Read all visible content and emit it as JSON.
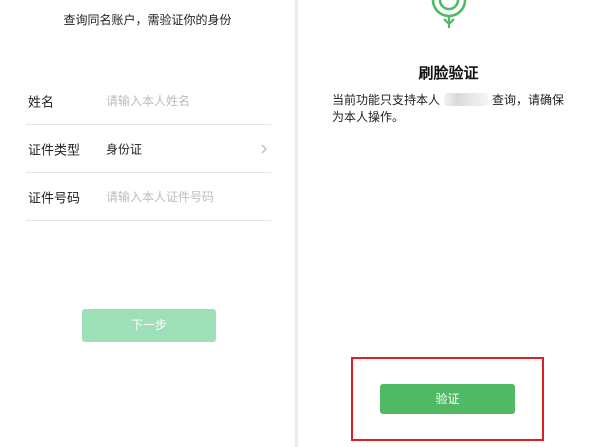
{
  "left_panel": {
    "header": "查询同名账户，需验证你的身份",
    "fields": [
      {
        "label": "姓名",
        "placeholder": "请输入本人姓名"
      },
      {
        "label": "证件类型",
        "value": "身份证"
      },
      {
        "label": "证件号码",
        "placeholder": "请输入本人证件号码"
      }
    ],
    "next_button": "下一步"
  },
  "right_panel": {
    "title": "刷脸验证",
    "desc_prefix": "当前功能只支持本人",
    "desc_suffix": "查询，请确保为本人操作。",
    "verify_button": "验证",
    "highlight_color": "#e02020"
  },
  "colors": {
    "primary_green": "#4fb964",
    "disabled_green": "#9ddfb6"
  },
  "icons": {
    "logo": "face-verify-logo-icon",
    "chevron": "chevron-right-icon"
  }
}
